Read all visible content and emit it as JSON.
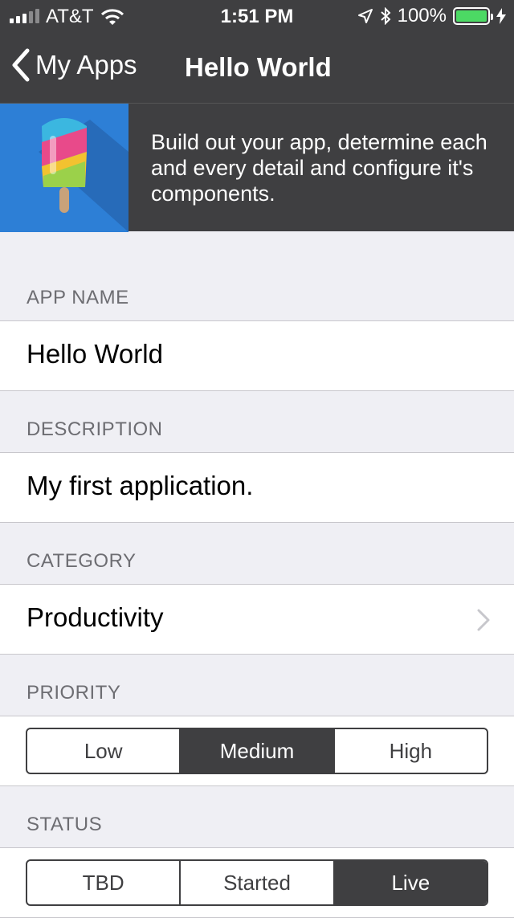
{
  "status_bar": {
    "carrier": "AT&T",
    "time": "1:51 PM",
    "battery_percent": "100%",
    "battery_color": "#4cd964"
  },
  "nav": {
    "back_label": "My Apps",
    "title": "Hello World"
  },
  "banner": {
    "description": "Build out your app, determine each and every detail and configure it's components.",
    "icon": "popsicle-icon",
    "art_background": "#2d7fd6"
  },
  "form": {
    "app_name": {
      "label": "APP NAME",
      "value": "Hello World"
    },
    "description": {
      "label": "DESCRIPTION",
      "value": "My first application."
    },
    "category": {
      "label": "CATEGORY",
      "value": "Productivity"
    },
    "priority": {
      "label": "PRIORITY",
      "options": [
        "Low",
        "Medium",
        "High"
      ],
      "selected": "Medium"
    },
    "status": {
      "label": "STATUS",
      "options": [
        "TBD",
        "Started",
        "Live"
      ],
      "selected": "Live"
    }
  },
  "colors": {
    "bar_background": "#3f3f41",
    "page_background": "#efeff4",
    "section_label": "#6d6d72"
  }
}
